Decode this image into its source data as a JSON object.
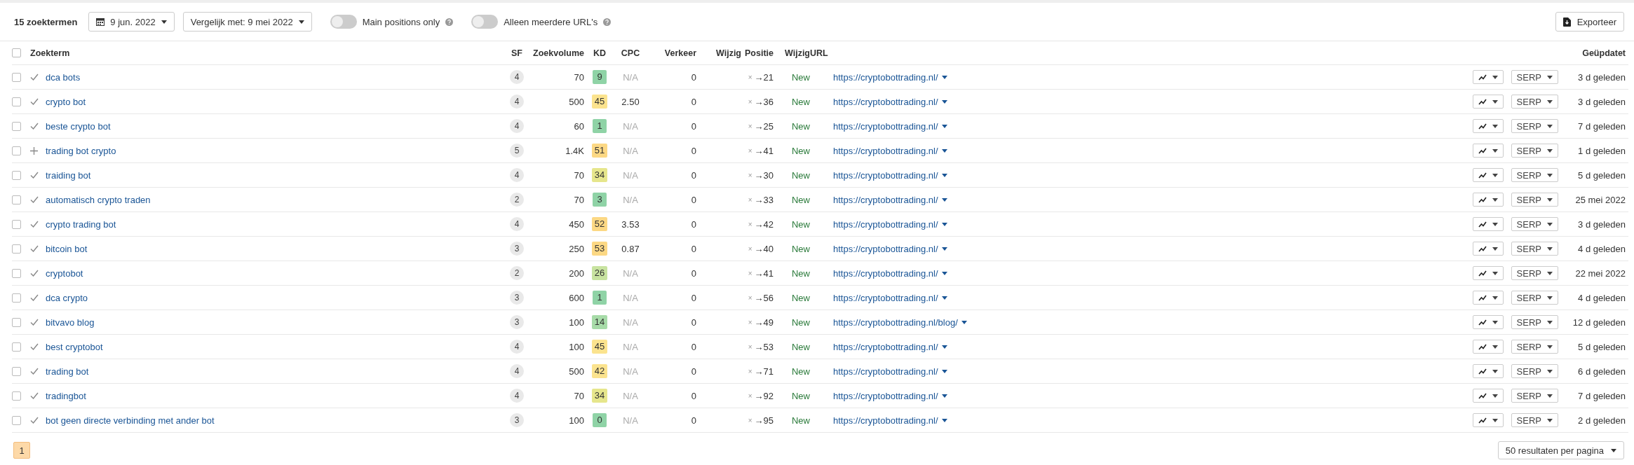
{
  "toolbar": {
    "count": "15 zoektermen",
    "date_picker": "9 jun. 2022",
    "compare_picker": "Vergelijk met: 9 mei 2022",
    "toggles": [
      {
        "label": "Main positions only",
        "on": false
      },
      {
        "label": "Alleen meerdere URL's",
        "on": false
      }
    ],
    "export_button": "Exporteer"
  },
  "table": {
    "select_all_checked": false,
    "columns": [
      "Zoekterm",
      "SF",
      "Zoekvolume",
      "KD",
      "CPC",
      "Verkeer",
      "Wijzig",
      "Positie",
      "Wijzig",
      "URL",
      "Geüpdatet"
    ],
    "rows": [
      {
        "checked": false,
        "kind": "check",
        "keyword": "dca bots",
        "sf": "4",
        "volume": "70",
        "kd": "9",
        "color": "#8fd3a6",
        "cpc": "N/A",
        "traffic": "0",
        "pos_from": "×",
        "pos_to": "→21",
        "change": "New",
        "url": "https://cryptobottrading.nl/",
        "serp": "SERP",
        "updated": "3 d geleden"
      },
      {
        "checked": false,
        "kind": "check",
        "keyword": "crypto bot",
        "sf": "4",
        "volume": "500",
        "kd": "45",
        "color": "#fbe38e",
        "cpc": "2.50",
        "traffic": "0",
        "pos_from": "×",
        "pos_to": "→36",
        "change": "New",
        "url": "https://cryptobottrading.nl/",
        "serp": "SERP",
        "updated": "3 d geleden"
      },
      {
        "checked": false,
        "kind": "check",
        "keyword": "beste crypto bot",
        "sf": "4",
        "volume": "60",
        "kd": "1",
        "color": "#8fd3a6",
        "cpc": "N/A",
        "traffic": "0",
        "pos_from": "×",
        "pos_to": "→25",
        "change": "New",
        "url": "https://cryptobottrading.nl/",
        "serp": "SERP",
        "updated": "7 d geleden"
      },
      {
        "checked": false,
        "kind": "plus",
        "keyword": "trading bot crypto",
        "sf": "5",
        "volume": "1.4K",
        "kd": "51",
        "color": "#fcd884",
        "cpc": "N/A",
        "traffic": "0",
        "pos_from": "×",
        "pos_to": "→41",
        "change": "New",
        "url": "https://cryptobottrading.nl/",
        "serp": "SERP",
        "updated": "1 d geleden"
      },
      {
        "checked": false,
        "kind": "check",
        "keyword": "traiding bot",
        "sf": "4",
        "volume": "70",
        "kd": "34",
        "color": "#e6e68c",
        "cpc": "N/A",
        "traffic": "0",
        "pos_from": "×",
        "pos_to": "→30",
        "change": "New",
        "url": "https://cryptobottrading.nl/",
        "serp": "SERP",
        "updated": "5 d geleden"
      },
      {
        "checked": false,
        "kind": "check",
        "keyword": "automatisch crypto traden",
        "sf": "2",
        "volume": "70",
        "kd": "3",
        "color": "#8fd3a6",
        "cpc": "N/A",
        "traffic": "0",
        "pos_from": "×",
        "pos_to": "→33",
        "change": "New",
        "url": "https://cryptobottrading.nl/",
        "serp": "SERP",
        "updated": "25 mei 2022"
      },
      {
        "checked": false,
        "kind": "check",
        "keyword": "crypto trading bot",
        "sf": "4",
        "volume": "450",
        "kd": "52",
        "color": "#fcd884",
        "cpc": "3.53",
        "traffic": "0",
        "pos_from": "×",
        "pos_to": "→42",
        "change": "New",
        "url": "https://cryptobottrading.nl/",
        "serp": "SERP",
        "updated": "3 d geleden"
      },
      {
        "checked": false,
        "kind": "check",
        "keyword": "bitcoin bot",
        "sf": "3",
        "volume": "250",
        "kd": "53",
        "color": "#fcd884",
        "cpc": "0.87",
        "traffic": "0",
        "pos_from": "×",
        "pos_to": "→40",
        "change": "New",
        "url": "https://cryptobottrading.nl/",
        "serp": "SERP",
        "updated": "4 d geleden"
      },
      {
        "checked": false,
        "kind": "check",
        "keyword": "cryptobot",
        "sf": "2",
        "volume": "200",
        "kd": "26",
        "color": "#c8e3a0",
        "cpc": "N/A",
        "traffic": "0",
        "pos_from": "×",
        "pos_to": "→41",
        "change": "New",
        "url": "https://cryptobottrading.nl/",
        "serp": "SERP",
        "updated": "22 mei 2022"
      },
      {
        "checked": false,
        "kind": "check",
        "keyword": "dca crypto",
        "sf": "3",
        "volume": "600",
        "kd": "1",
        "color": "#8fd3a6",
        "cpc": "N/A",
        "traffic": "0",
        "pos_from": "×",
        "pos_to": "→56",
        "change": "New",
        "url": "https://cryptobottrading.nl/",
        "serp": "SERP",
        "updated": "4 d geleden"
      },
      {
        "checked": false,
        "kind": "check",
        "keyword": "bitvavo blog",
        "sf": "3",
        "volume": "100",
        "kd": "14",
        "color": "#a7dba8",
        "cpc": "N/A",
        "traffic": "0",
        "pos_from": "×",
        "pos_to": "→49",
        "change": "New",
        "url": "https://cryptobottrading.nl/blog/",
        "serp": "SERP",
        "updated": "12 d geleden"
      },
      {
        "checked": false,
        "kind": "check",
        "keyword": "best cryptobot",
        "sf": "4",
        "volume": "100",
        "kd": "45",
        "color": "#fbe38e",
        "cpc": "N/A",
        "traffic": "0",
        "pos_from": "×",
        "pos_to": "→53",
        "change": "New",
        "url": "https://cryptobottrading.nl/",
        "serp": "SERP",
        "updated": "5 d geleden"
      },
      {
        "checked": false,
        "kind": "check",
        "keyword": "trading bot",
        "sf": "4",
        "volume": "500",
        "kd": "42",
        "color": "#fbe38e",
        "cpc": "N/A",
        "traffic": "0",
        "pos_from": "×",
        "pos_to": "→71",
        "change": "New",
        "url": "https://cryptobottrading.nl/",
        "serp": "SERP",
        "updated": "6 d geleden"
      },
      {
        "checked": false,
        "kind": "check",
        "keyword": "tradingbot",
        "sf": "4",
        "volume": "70",
        "kd": "34",
        "color": "#e6e68c",
        "cpc": "N/A",
        "traffic": "0",
        "pos_from": "×",
        "pos_to": "→92",
        "change": "New",
        "url": "https://cryptobottrading.nl/",
        "serp": "SERP",
        "updated": "7 d geleden"
      },
      {
        "checked": false,
        "kind": "check",
        "keyword": "bot geen directe verbinding met ander bot",
        "sf": "3",
        "volume": "100",
        "kd": "0",
        "color": "#8fd3a6",
        "cpc": "N/A",
        "traffic": "0",
        "pos_from": "×",
        "pos_to": "→95",
        "change": "New",
        "url": "https://cryptobottrading.nl/",
        "serp": "SERP",
        "updated": "2 d geleden"
      }
    ]
  },
  "footer": {
    "pages": [
      {
        "label": "1",
        "selected": true
      }
    ],
    "per_page": "50 resultaten per pagina"
  }
}
